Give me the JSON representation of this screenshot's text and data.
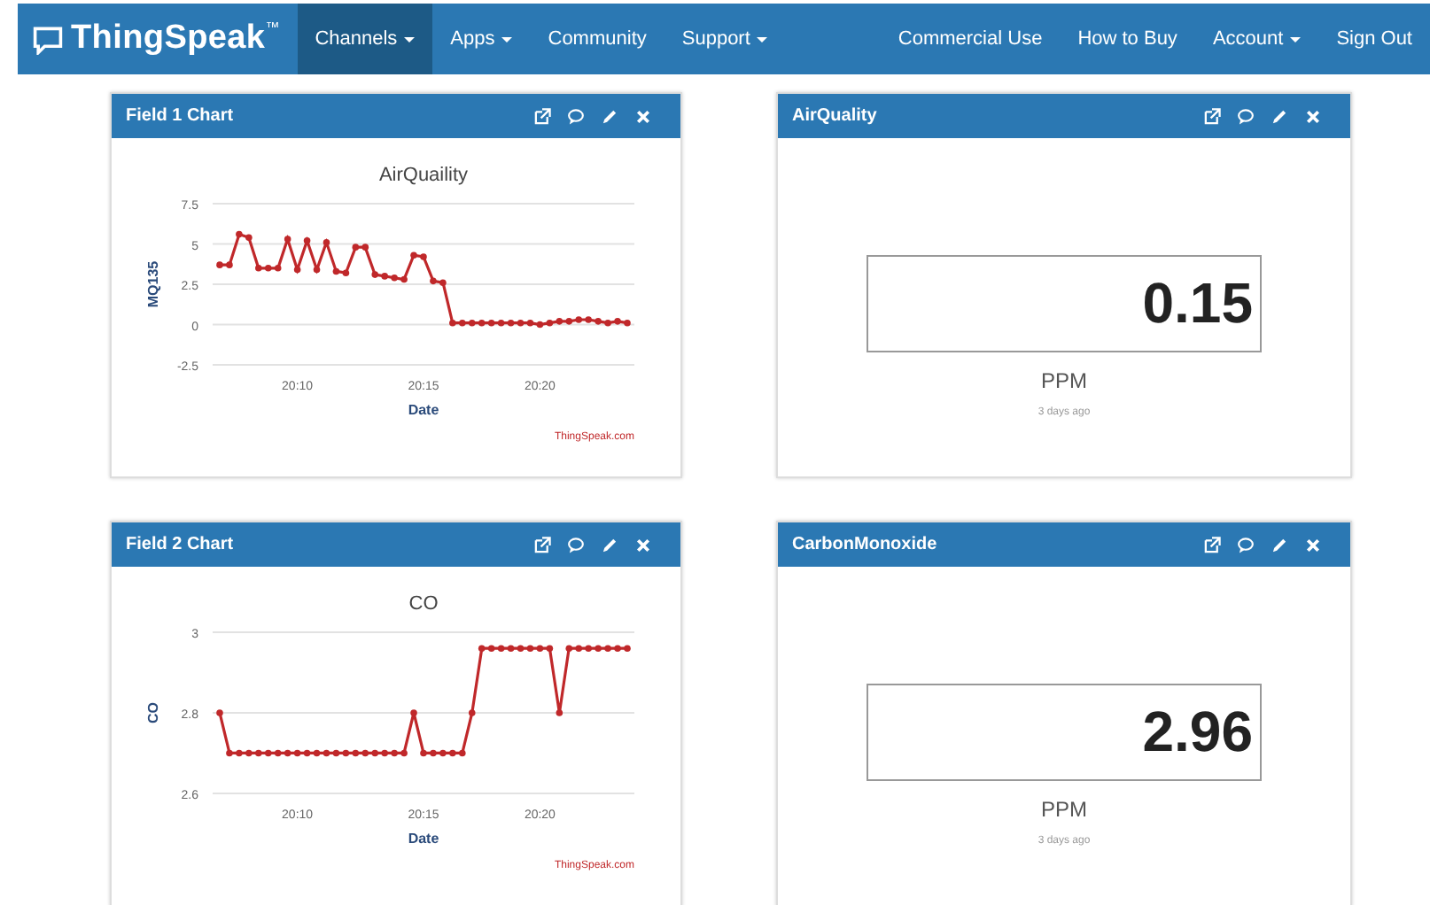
{
  "navbar": {
    "brand": "ThingSpeak",
    "trademark": "™",
    "left_items": [
      {
        "label": "Channels",
        "dropdown": true,
        "selected": true
      },
      {
        "label": "Apps",
        "dropdown": true,
        "selected": false
      },
      {
        "label": "Community",
        "dropdown": false,
        "selected": false
      },
      {
        "label": "Support",
        "dropdown": true,
        "selected": false
      }
    ],
    "right_items": [
      {
        "label": "Commercial Use",
        "dropdown": false,
        "selected": false
      },
      {
        "label": "How to Buy",
        "dropdown": false,
        "selected": false
      },
      {
        "label": "Account",
        "dropdown": true,
        "selected": false
      },
      {
        "label": "Sign Out",
        "dropdown": false,
        "selected": false
      }
    ]
  },
  "panels": [
    {
      "kind": "chart",
      "title": "Field 1 Chart",
      "credit": "ThingSpeak.com",
      "chart_data": {
        "type": "line",
        "title": "AirQuaility",
        "xlabel": "Date",
        "ylabel": "MQ135",
        "grid": true,
        "ylim": [
          -2.5,
          7.5
        ],
        "yticks": [
          -2.5,
          0,
          2.5,
          5,
          7.5
        ],
        "categories": [
          null,
          null,
          null,
          null,
          null,
          null,
          null,
          null,
          "20:10",
          null,
          null,
          null,
          null,
          null,
          null,
          null,
          null,
          null,
          null,
          null,
          null,
          "20:15",
          null,
          null,
          null,
          null,
          null,
          null,
          null,
          null,
          null,
          null,
          null,
          "20:20",
          null,
          null,
          null,
          null,
          null,
          null,
          null,
          null,
          null
        ],
        "series": [
          {
            "color": "#c0282a",
            "marker": true,
            "values": [
              3.7,
              3.7,
              5.6,
              5.4,
              3.5,
              3.5,
              3.5,
              5.3,
              3.4,
              5.2,
              3.4,
              5.1,
              3.3,
              3.2,
              4.8,
              4.8,
              3.1,
              3.0,
              2.9,
              2.8,
              4.3,
              4.2,
              2.7,
              2.6,
              0.1,
              0.1,
              0.1,
              0.1,
              0.1,
              0.1,
              0.1,
              0.1,
              0.1,
              0.0,
              0.1,
              0.2,
              0.2,
              0.3,
              0.3,
              0.2,
              0.1,
              0.2,
              0.1
            ]
          }
        ]
      }
    },
    {
      "kind": "numeric",
      "title": "AirQuality",
      "value": "0.15",
      "unit": "PPM",
      "updated": "3 days ago"
    },
    {
      "kind": "chart",
      "title": "Field 2 Chart",
      "credit": "ThingSpeak.com",
      "chart_data": {
        "type": "line",
        "title": "CO",
        "xlabel": "Date",
        "ylabel": "CO",
        "grid": true,
        "ylim": [
          2.6,
          3
        ],
        "yticks": [
          2.6,
          2.8,
          3
        ],
        "categories": [
          null,
          null,
          null,
          null,
          null,
          null,
          null,
          null,
          "20:10",
          null,
          null,
          null,
          null,
          null,
          null,
          null,
          null,
          null,
          null,
          null,
          null,
          "20:15",
          null,
          null,
          null,
          null,
          null,
          null,
          null,
          null,
          null,
          null,
          null,
          "20:20",
          null,
          null,
          null,
          null,
          null,
          null,
          null,
          null,
          null
        ],
        "series": [
          {
            "color": "#c0282a",
            "marker": true,
            "values": [
              2.8,
              2.7,
              2.7,
              2.7,
              2.7,
              2.7,
              2.7,
              2.7,
              2.7,
              2.7,
              2.7,
              2.7,
              2.7,
              2.7,
              2.7,
              2.7,
              2.7,
              2.7,
              2.7,
              2.7,
              2.8,
              2.7,
              2.7,
              2.7,
              2.7,
              2.7,
              2.8,
              2.96,
              2.96,
              2.96,
              2.96,
              2.96,
              2.96,
              2.96,
              2.96,
              2.8,
              2.96,
              2.96,
              2.96,
              2.96,
              2.96,
              2.96,
              2.96
            ]
          }
        ]
      }
    },
    {
      "kind": "numeric",
      "title": "CarbonMonoxide",
      "value": "2.96",
      "unit": "PPM",
      "updated": "3 days ago"
    }
  ]
}
